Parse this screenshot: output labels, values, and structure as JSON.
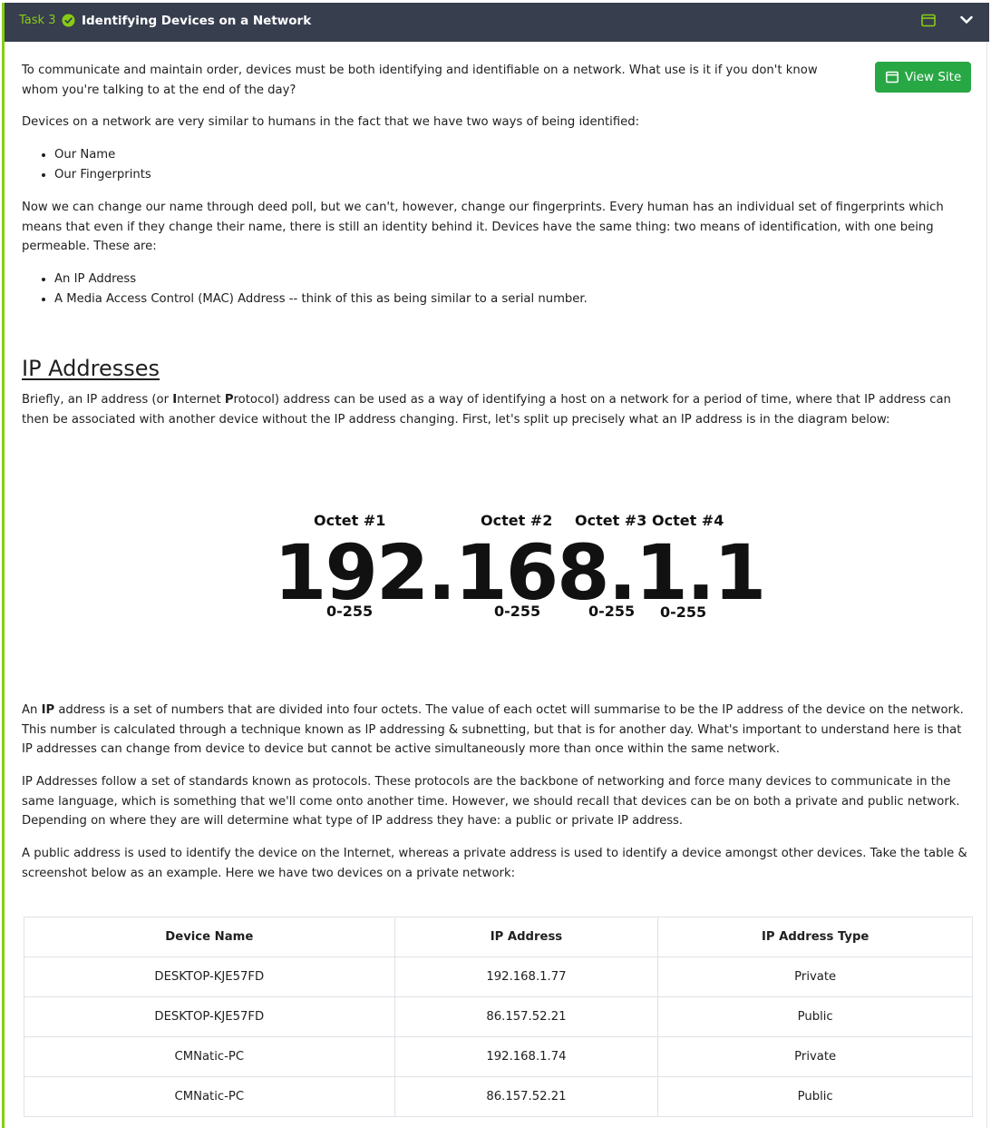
{
  "header": {
    "task_label": "Task 3",
    "title": "Identifying Devices on a Network",
    "icons": [
      "check-circle-icon",
      "window-icon",
      "chevron-down-icon"
    ],
    "accent_color": "#88cc14",
    "background_color": "#373e4e"
  },
  "view_site": {
    "label": "View Site",
    "color": "#28a745"
  },
  "intro": {
    "p1": "To communicate and maintain order, devices must be both identifying and identifiable on a network. What use is it if you don't know whom you're talking to at the end of the day?",
    "p2": "Devices on a network are very similar to humans in the fact that we have two ways of being identified:",
    "bullets1": [
      "Our Name",
      "Our Fingerprints"
    ],
    "p3": "Now we can change our name through deed poll, but we can't, however, change our fingerprints. Every human has an individual set of fingerprints which means that even if they change their name, there is still an identity behind it. Devices have the same thing: two means of identification, with one being permeable. These are:",
    "bullets2": [
      "An IP Address",
      "A Media Access Control (MAC) Address -- think of this as being similar to a serial number."
    ]
  },
  "ip_section": {
    "heading": "IP Addresses",
    "p1_start": "Briefly, an IP address (or ",
    "p1_I": "I",
    "p1_mid1": "nternet ",
    "p1_P": "P",
    "p1_end": "rotocol) address can be used as a way of identifying a host on a network for a period of time, where that IP address can then be associated with another device without the IP address changing. First, let's split up precisely what an IP address is in the diagram below:",
    "diagram": {
      "octet_labels": [
        "Octet #1",
        "Octet #2",
        "Octet #3",
        "Octet #4"
      ],
      "ip": "192.168.1.1",
      "ranges": [
        "0-255",
        "0-255",
        "0-255",
        "0-255"
      ]
    },
    "p2_start": "An ",
    "p2_bold": "IP",
    "p2_end": " address is a set of numbers that are divided into four octets. The value of each octet will summarise to be the IP address of the device on the network. This number is calculated through a technique known as IP addressing & subnetting, but that is for another day. What's important to understand here is that IP addresses can change from device to device but cannot be active simultaneously more than once within the same network.",
    "p3": "IP Addresses follow a set of standards known as protocols. These protocols are the backbone of networking and force many devices to communicate in the same language, which is something that we'll come onto another time. However, we should recall that devices can be on both a private and public network. Depending on where they are will determine what type of IP address they have: a public or private IP address.",
    "p4": "A public address is used to identify the device on the Internet, whereas a private address is used to identify a device amongst other devices. Take the table & screenshot below as an example. Here we have two devices on a private network:"
  },
  "table": {
    "headers": [
      "Device Name",
      "IP Address",
      "IP Address Type"
    ],
    "rows": [
      [
        "DESKTOP-KJE57FD",
        "192.168.1.77",
        "Private"
      ],
      [
        "DESKTOP-KJE57FD",
        "86.157.52.21",
        "Public"
      ],
      [
        "CMNatic-PC",
        "192.168.1.74",
        "Private"
      ],
      [
        "CMNatic-PC",
        "86.157.52.21",
        "Public"
      ]
    ]
  }
}
